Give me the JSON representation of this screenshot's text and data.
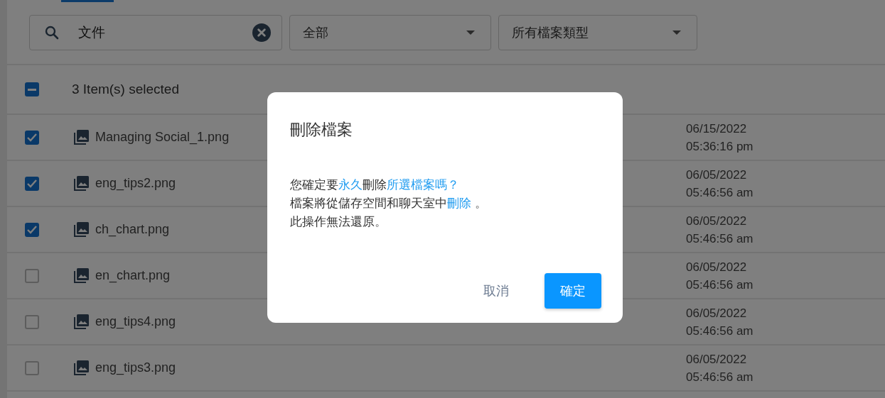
{
  "search": {
    "value": "文件"
  },
  "filters": [
    {
      "value": "全部"
    },
    {
      "value": "所有檔案類型"
    }
  ],
  "header": {
    "indeterminate": true,
    "label": "3 Item(s) selected"
  },
  "files": [
    {
      "checked": true,
      "name": "Managing Social_1.png",
      "date": "06/15/2022",
      "time": "05:36:16 pm"
    },
    {
      "checked": true,
      "name": "eng_tips2.png",
      "date": "06/05/2022",
      "time": "05:46:56 am"
    },
    {
      "checked": true,
      "name": "ch_chart.png",
      "date": "06/05/2022",
      "time": "05:46:56 am"
    },
    {
      "checked": false,
      "name": "en_chart.png",
      "date": "06/05/2022",
      "time": "05:46:56 am"
    },
    {
      "checked": false,
      "name": "eng_tips4.png",
      "date": "06/05/2022",
      "time": "05:46:56 am"
    },
    {
      "checked": false,
      "name": "eng_tips3.png",
      "date": "06/05/2022",
      "time": "05:46:56 am"
    }
  ],
  "dialog": {
    "title": "刪除檔案",
    "lines": [
      [
        {
          "text": "您確定要",
          "highlight": false
        },
        {
          "text": "永久",
          "highlight": true
        },
        {
          "text": "刪除",
          "highlight": false
        },
        {
          "text": "所選檔案嗎？",
          "highlight": true
        }
      ],
      [
        {
          "text": "檔案將從儲存空間和聊天室中",
          "highlight": false
        },
        {
          "text": "刪除",
          "highlight": true
        },
        {
          "text": " 。",
          "highlight": false
        }
      ],
      [
        {
          "text": "此操作無法還原。",
          "highlight": false
        }
      ]
    ],
    "cancel": "取消",
    "confirm": "確定"
  }
}
